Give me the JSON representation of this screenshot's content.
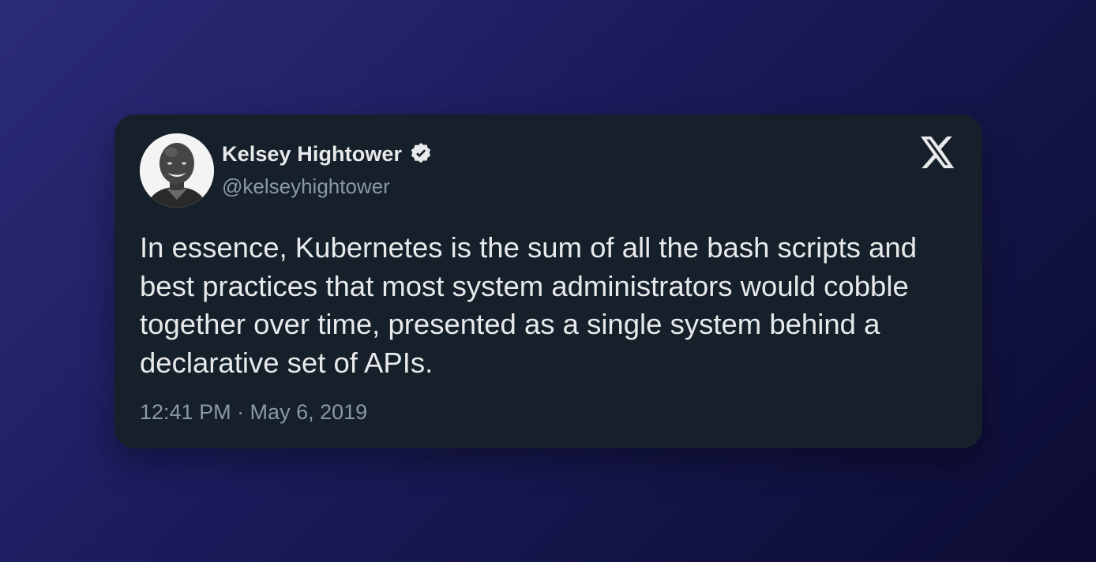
{
  "author": {
    "display_name": "Kelsey Hightower",
    "handle": "@kelseyhightower",
    "verified": true,
    "avatar_icon": "avatar-photo"
  },
  "platform_icon": "x-logo-icon",
  "tweet": {
    "text": "In essence, Kubernetes is the sum of all the bash scripts and best practices that most system administrators would cobble together over time, presented as a single system behind a declarative set of APIs.",
    "timestamp": "12:41 PM · May 6, 2019"
  },
  "colors": {
    "background_start": "#2b2c78",
    "background_end": "#0c0b33",
    "card": "#16202a",
    "primary_text": "#e7e9ea",
    "secondary_text": "#8b98a5"
  }
}
